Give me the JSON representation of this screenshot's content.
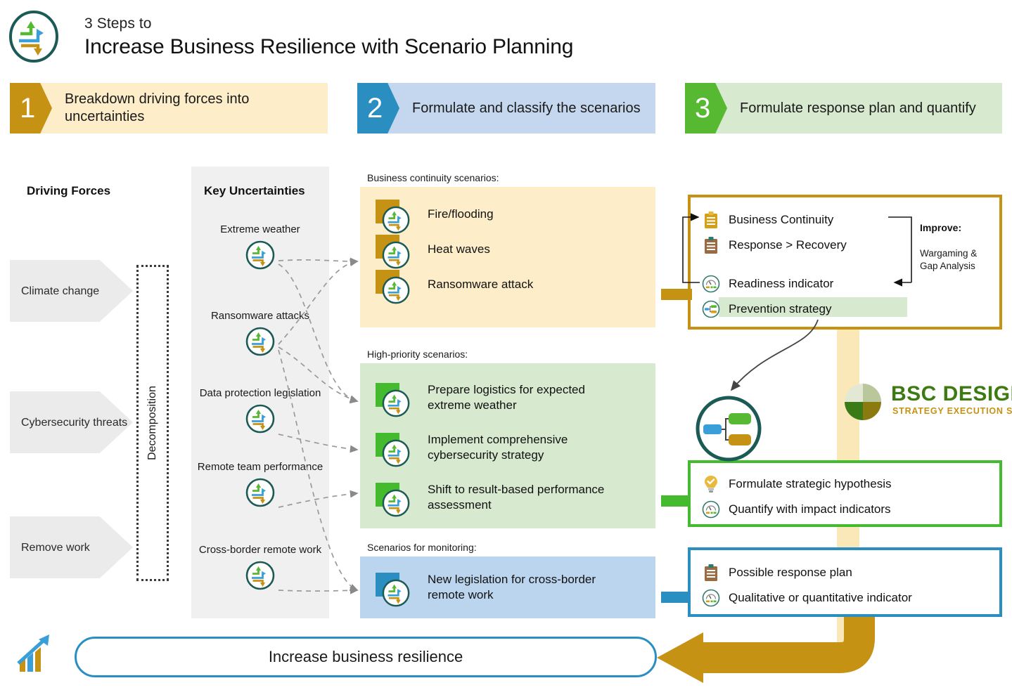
{
  "header": {
    "sub": "3 Steps to",
    "title": "Increase Business Resilience with Scenario Planning",
    "logo_icon": "three-arrows-circle-icon"
  },
  "steps": [
    {
      "num": "1",
      "text": "Breakdown driving forces into uncertainties",
      "color": "#c69214",
      "bg": "#fdeec9"
    },
    {
      "num": "2",
      "text": "Formulate and classify the scenarios",
      "color": "#2a8fc0",
      "bg": "#c5d7ee"
    },
    {
      "num": "3",
      "text": "Formulate response plan and quantify",
      "color": "#57b832",
      "bg": "#d7e9cf"
    }
  ],
  "columns": {
    "driving_forces_header": "Driving Forces",
    "key_uncertainties_header": "Key Uncertainties",
    "decomposition_label": "Decomposition"
  },
  "driving_forces": [
    {
      "label": "Climate change"
    },
    {
      "label": "Cybersecurity threats"
    },
    {
      "label": "Remove work"
    }
  ],
  "uncertainties": [
    {
      "label": "Extreme weather"
    },
    {
      "label": "Ransomware attacks"
    },
    {
      "label": "Data protection legislation"
    },
    {
      "label": "Remote team performance"
    },
    {
      "label": "Cross-border remote work"
    }
  ],
  "scenario_groups": [
    {
      "caption": "Business continuity scenarios:",
      "accent": "#c69214",
      "bg": "#fdeec9",
      "items": [
        {
          "label": "Fire/flooding"
        },
        {
          "label": "Heat waves"
        },
        {
          "label": "Ransomware attack"
        }
      ]
    },
    {
      "caption": "High-priority scenarios:",
      "accent": "#44bb2e",
      "bg": "#d7e9cf",
      "items": [
        {
          "label": "Prepare logistics for expected extreme weather"
        },
        {
          "label": "Implement comprehensive cybersecurity strategy"
        },
        {
          "label": "Shift to result-based performance assessment"
        }
      ]
    },
    {
      "caption": "Scenarios for monitoring:",
      "accent": "#2a8fc0",
      "bg": "#bcd5ee",
      "items": [
        {
          "label": "New legislation for cross-border remote work"
        }
      ]
    }
  ],
  "response_boxes": [
    {
      "border": "#c69214",
      "rows": [
        {
          "icon": "clipboard-gold-icon",
          "label": "Business Continuity"
        },
        {
          "icon": "clipboard-brown-icon",
          "label": "Response > Recovery"
        },
        {
          "icon": "gauge-icon",
          "label": "Readiness indicator"
        },
        {
          "icon": "strategy-map-icon",
          "label": "Prevention strategy",
          "highlighted": true
        }
      ]
    },
    {
      "border": "#44bb2e",
      "rows": [
        {
          "icon": "lightbulb-check-icon",
          "label": "Formulate strategic hypothesis"
        },
        {
          "icon": "gauge-icon",
          "label": "Quantify with impact indicators"
        }
      ]
    },
    {
      "border": "#2a8fc0",
      "rows": [
        {
          "icon": "clipboard-brown-icon",
          "label": "Possible response plan"
        },
        {
          "icon": "gauge-icon",
          "label": "Qualitative or quantitative indicator"
        }
      ]
    }
  ],
  "improve": {
    "label": "Improve",
    "colon": ":",
    "text": "Wargaming & Gap Analysis"
  },
  "brand": {
    "name": "BSC DESIGNER",
    "tagline": "STRATEGY EXECUTION SOFTWARE",
    "name_color": "#3d7a12",
    "tagline_color": "#c69214"
  },
  "bottom": {
    "label": "Increase business resilience",
    "icon": "growth-chart-icon",
    "border_color": "#2a8fc0"
  }
}
